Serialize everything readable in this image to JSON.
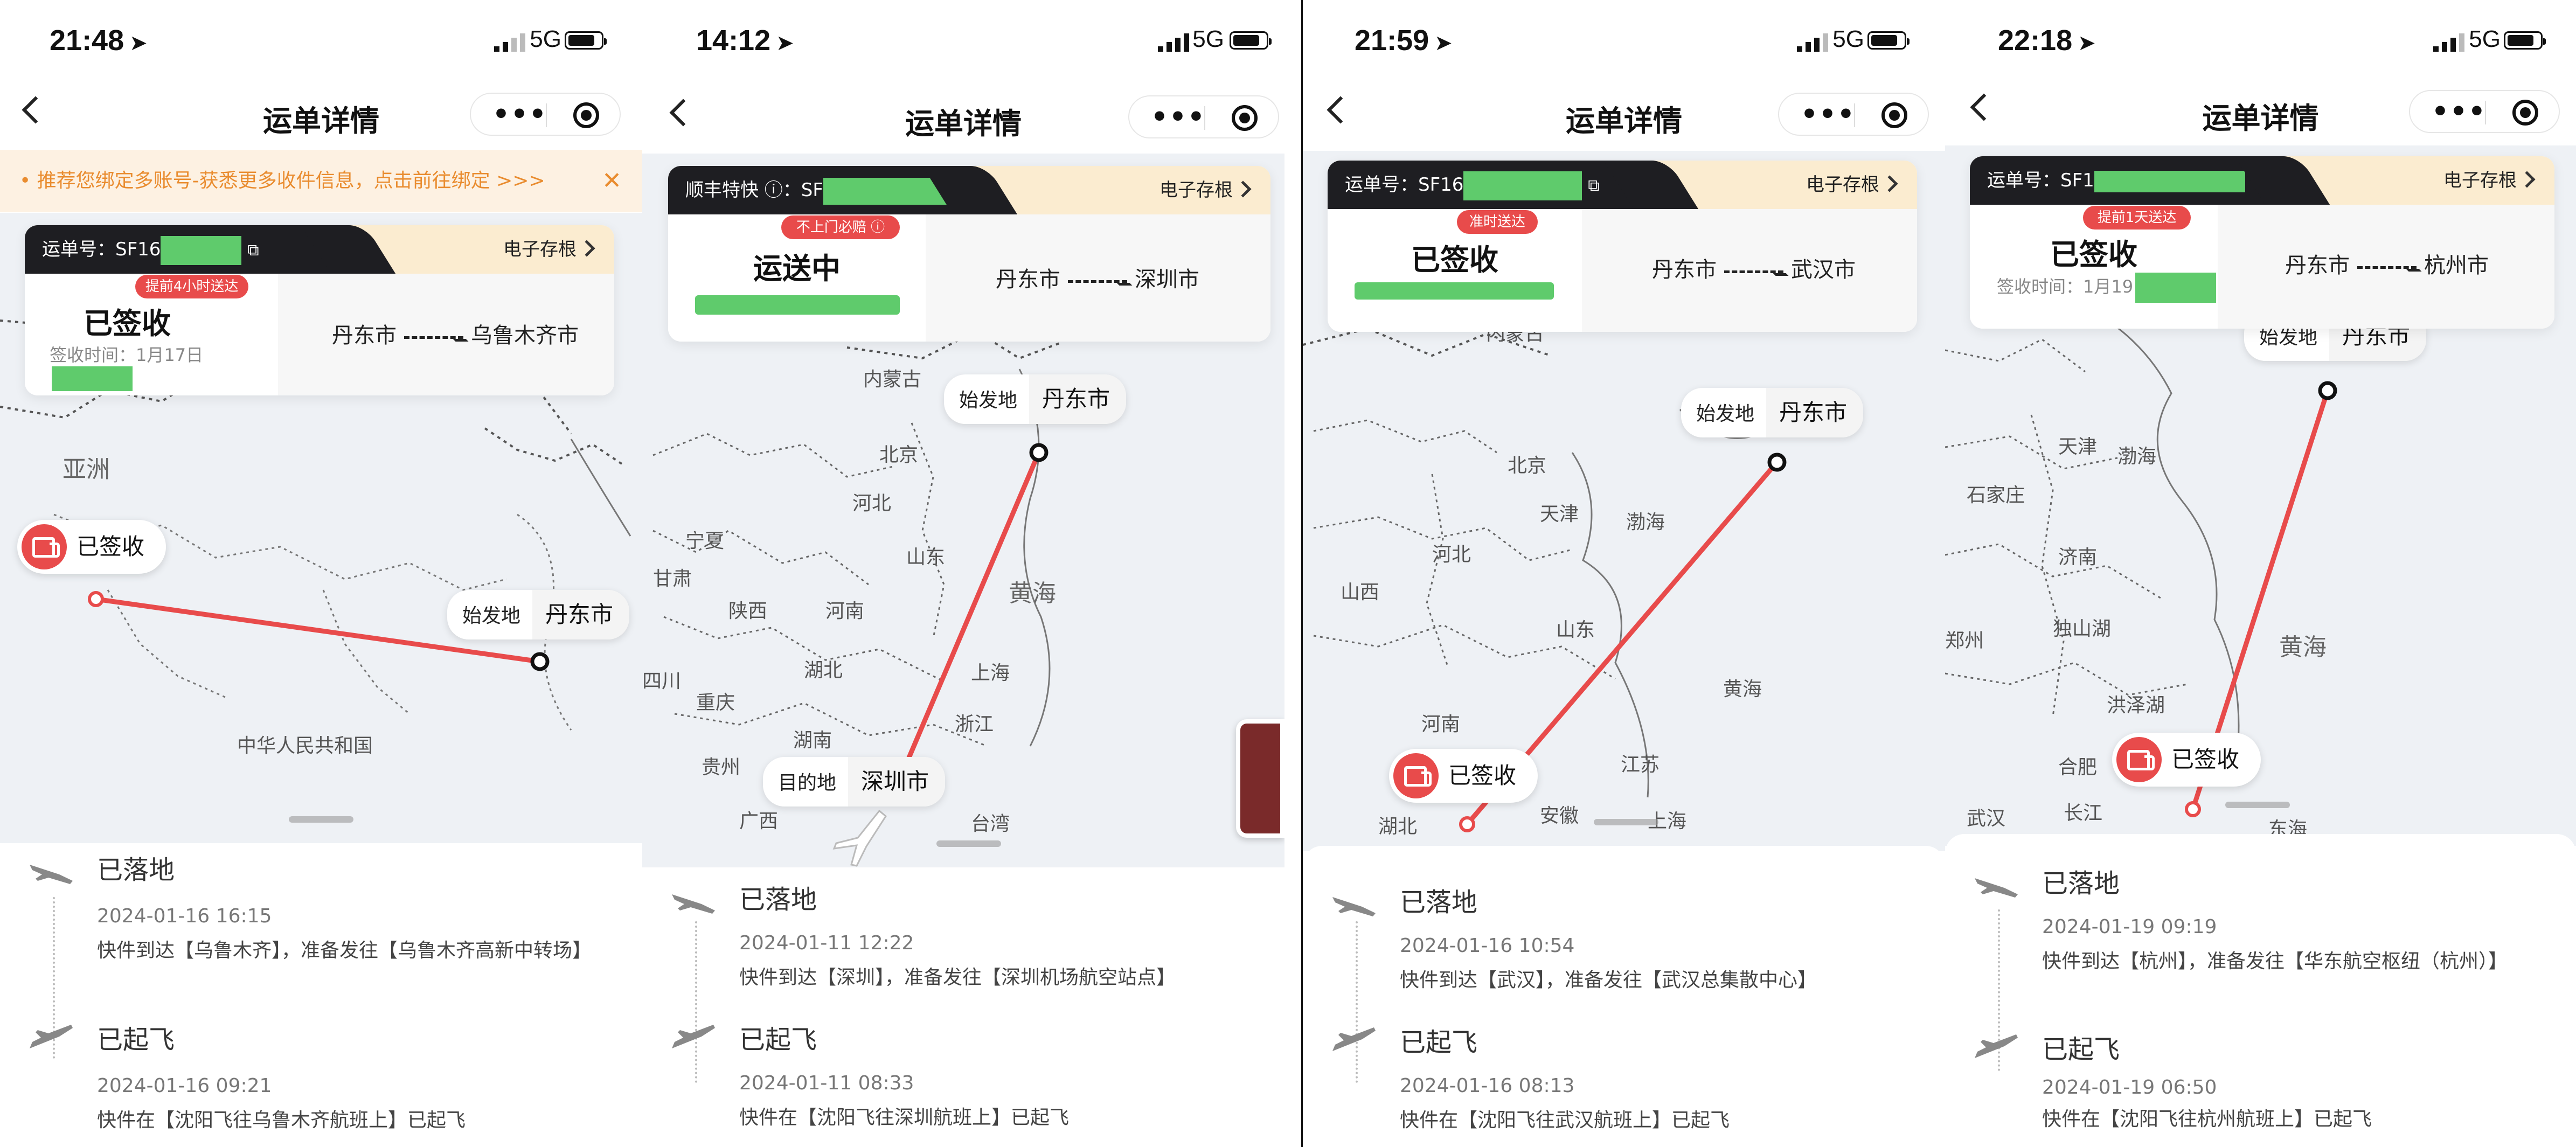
{
  "screens": [
    {
      "time": "21:48",
      "network": "5G",
      "title": "运单详情",
      "banner": "• 推荐您绑定多账号-获悉更多收件信息，点击前往绑定 >>>",
      "waybill_label": "运单号：SF16",
      "archive": "电子存根",
      "status": "已签收",
      "tag": "提前4小时送达",
      "sign_time": "签收时间：1月17日",
      "from": "丹东市",
      "to": "乌鲁木齐市",
      "map": {
        "origin_label": "始发地",
        "origin_city": "丹东市",
        "dest_status": "已签收",
        "labels": [
          "亚洲",
          "中华人民共和国"
        ]
      },
      "events": [
        {
          "title": "已落地",
          "datetime": "2024-01-16 16:15",
          "msg": "快件到达【乌鲁木齐】，准备发往【乌鲁木齐高新中转场】"
        },
        {
          "title": "已起飞",
          "datetime": "2024-01-16 09:21",
          "msg": "快件在【沈阳飞往乌鲁木齐航班上】已起飞"
        }
      ]
    },
    {
      "time": "14:12",
      "network": "5G",
      "title": "运单详情",
      "waybill_label": "顺丰特快 ⓘ：SF",
      "archive": "电子存根",
      "status": "运送中",
      "tag": "不上门必赔 ⓘ",
      "from": "丹东市",
      "to": "深圳市",
      "map": {
        "origin_label": "始发地",
        "origin_city": "丹东市",
        "dest_label": "目的地",
        "dest_city": "深圳市",
        "labels": [
          "内蒙古",
          "北京",
          "河北",
          "山东",
          "宁夏",
          "甘肃",
          "陕西",
          "河南",
          "湖北",
          "重庆",
          "湖南",
          "贵州",
          "广西",
          "浙江",
          "上海",
          "黄海",
          "台湾",
          "四川"
        ]
      },
      "events": [
        {
          "title": "已落地",
          "datetime": "2024-01-11 12:22",
          "msg": "快件到达【深圳】，准备发往【深圳机场航空站点】"
        },
        {
          "title": "已起飞",
          "datetime": "2024-01-11 08:33",
          "msg": "快件在【沈阳飞往深圳航班上】已起飞"
        }
      ]
    },
    {
      "time": "21:59",
      "network": "5G",
      "title": "运单详情",
      "waybill_label": "运单号：SF16",
      "archive": "电子存根",
      "status": "已签收",
      "tag": "准时送达",
      "from": "丹东市",
      "to": "武汉市",
      "map": {
        "origin_label": "始发地",
        "origin_city": "丹东市",
        "dest_status": "已签收",
        "labels": [
          "北京",
          "天津",
          "河北",
          "渤海",
          "山西",
          "山东",
          "黄海",
          "河南",
          "江苏",
          "安徽",
          "上海",
          "湖北",
          "内蒙古"
        ]
      },
      "events": [
        {
          "title": "已落地",
          "datetime": "2024-01-16 10:54",
          "msg": "快件到达【武汉】，准备发往【武汉总集散中心】"
        },
        {
          "title": "已起飞",
          "datetime": "2024-01-16 08:13",
          "msg": "快件在【沈阳飞往武汉航班上】已起飞"
        }
      ]
    },
    {
      "time": "22:18",
      "network": "5G",
      "title": "运单详情",
      "waybill_label": "运单号：SF1",
      "archive": "电子存根",
      "status": "已签收",
      "tag": "提前1天送达",
      "sign_time": "签收时间：1月19",
      "from": "丹东市",
      "to": "杭州市",
      "map": {
        "origin_label": "始发地",
        "origin_city": "丹东市",
        "dest_status": "已签收",
        "labels": [
          "天津",
          "渤海",
          "石家庄",
          "济南",
          "独山湖",
          "郑州",
          "黄海",
          "洪泽湖",
          "合肥",
          "长江",
          "武汉",
          "东海"
        ]
      },
      "events": [
        {
          "title": "已落地",
          "datetime": "2024-01-19 09:19",
          "msg": "快件到达【杭州】，准备发往【华东航空枢纽（杭州）】"
        },
        {
          "title": "已起飞",
          "datetime": "2024-01-19 06:50",
          "msg": "快件在【沈阳飞往杭州航班上】已起飞"
        }
      ]
    }
  ],
  "colors": {
    "accent": "#e84b4b",
    "route": "#e84b4b",
    "mask": "#5fcb6c",
    "banner_bg": "#fdf1e2",
    "banner_text": "#e98c2f"
  }
}
